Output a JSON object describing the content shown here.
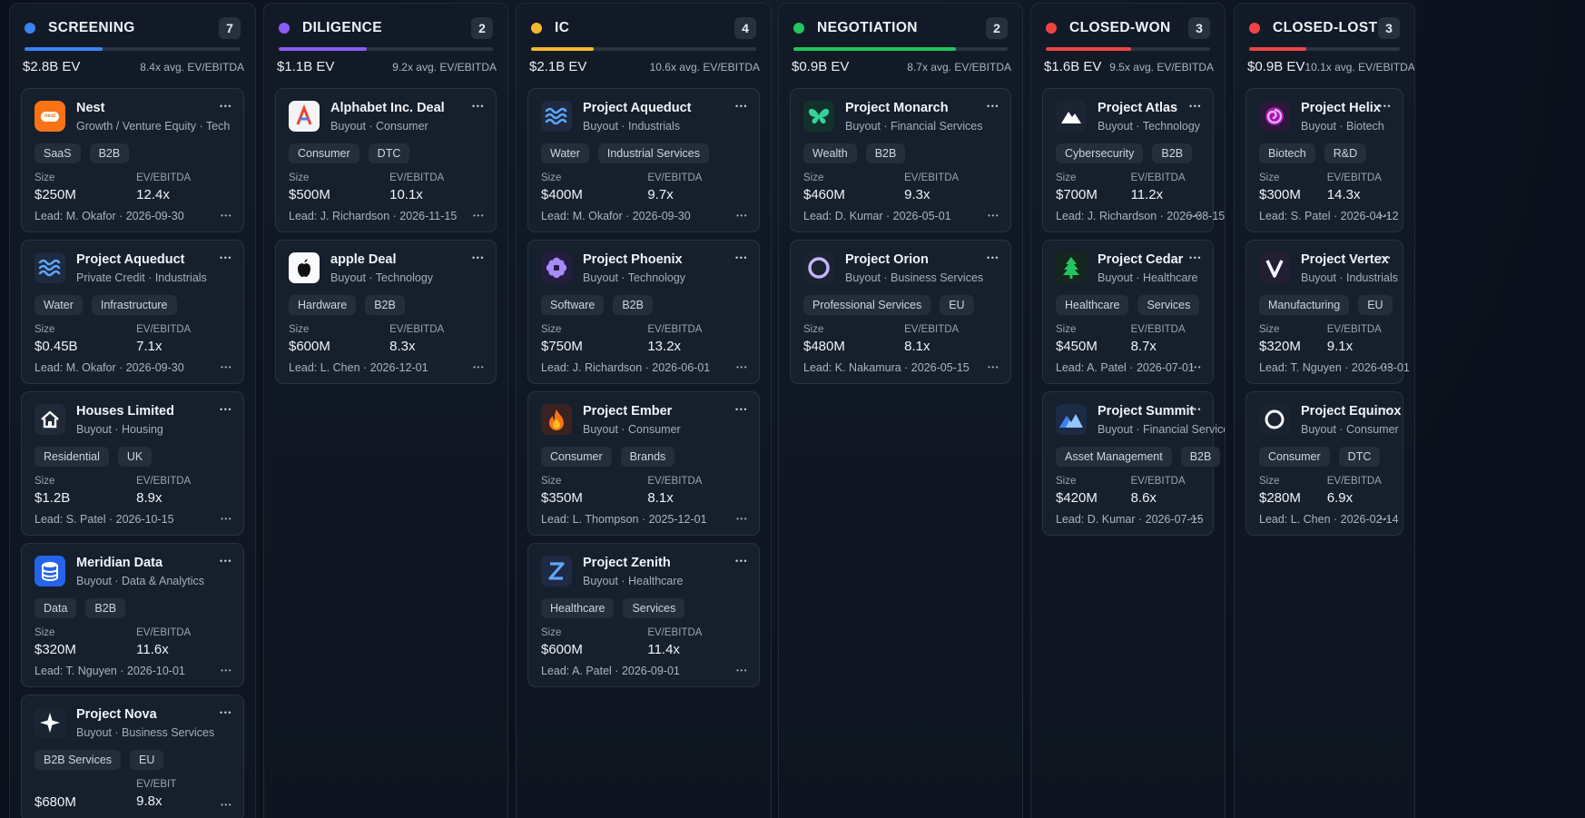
{
  "columns": [
    {
      "stage": "SCREENING",
      "count": "7",
      "dot": "#3b82f6",
      "bar": "#3b82f6",
      "progress": 0.36,
      "ev": "$2.8B EV",
      "avg": "8.4x avg. EV/EBITDA",
      "cards": [
        {
          "name": "Nest",
          "sub": "Growth / Venture Equity · Tech",
          "tags": [
            "SaaS",
            "B2B"
          ],
          "size_label": "Size",
          "size": "$250M",
          "ev_label": "EV/EBITDA",
          "ev": "12.4x",
          "lead": "Lead: M. Okafor · 2026-09-30",
          "icon": "nest-logo-icon"
        },
        {
          "name": "Project Aqueduct",
          "sub": "Private Credit · Industrials",
          "tags": [
            "Water",
            "Infrastructure"
          ],
          "size_label": "Size",
          "size": "$0.45B",
          "ev_label": "EV/EBITDA",
          "ev": "7.1x",
          "lead": "Lead: M. Okafor · 2026-09-30",
          "icon": "waves-icon"
        },
        {
          "name": "Houses Limited",
          "sub": "Buyout · Housing",
          "tags": [
            "Residential",
            "UK"
          ],
          "size_label": "Size",
          "size": "$1.2B",
          "ev_label": "EV/EBITDA",
          "ev": "8.9x",
          "lead": "Lead: S. Patel · 2026-10-15",
          "icon": "house-icon"
        },
        {
          "name": "Meridian Data",
          "sub": "Buyout · Data & Analytics",
          "tags": [
            "Data",
            "B2B"
          ],
          "size_label": "Size",
          "size": "$320M",
          "ev_label": "EV/EBITDA",
          "ev": "11.6x",
          "lead": "Lead: T. Nguyen · 2026-10-01",
          "icon": "database-icon"
        },
        {
          "name": "Project Nova",
          "sub": "Buyout · Business Services",
          "tags": [
            "B2B Services",
            "EU"
          ],
          "size_label": "",
          "size": "$680M",
          "ev_label": "EV/EBIT",
          "ev": "9.8x",
          "lead": "",
          "icon": "sparkle-icon"
        }
      ]
    },
    {
      "stage": "DILIGENCE",
      "count": "2",
      "dot": "#8b5cf6",
      "bar": "#8b5cf6",
      "progress": 0.41,
      "ev": "$1.1B EV",
      "avg": "9.2x avg. EV/EBITDA",
      "cards": [
        {
          "name": "Alphabet Inc. Deal",
          "sub": "Buyout · Consumer",
          "tags": [
            "Consumer",
            "DTC"
          ],
          "size_label": "Size",
          "size": "$500M",
          "ev_label": "EV/EBITDA",
          "ev": "10.1x",
          "lead": "Lead: J. Richardson · 2026-11-15",
          "icon": "letter-a-logo-icon"
        },
        {
          "name": "apple Deal",
          "sub": "Buyout · Technology",
          "tags": [
            "Hardware",
            "B2B"
          ],
          "size_label": "Size",
          "size": "$600M",
          "ev_label": "EV/EBITDA",
          "ev": "8.3x",
          "lead": "Lead: L. Chen · 2026-12-01",
          "icon": "apple-logo-icon"
        }
      ]
    },
    {
      "stage": "IC",
      "count": "4",
      "dot": "#f5b82e",
      "bar": "#f5b82e",
      "progress": 0.28,
      "ev": "$2.1B EV",
      "avg": "10.6x avg. EV/EBITDA",
      "cards": [
        {
          "name": "Project Aqueduct",
          "sub": "Buyout · Industrials",
          "tags": [
            "Water",
            "Industrial Services"
          ],
          "size_label": "Size",
          "size": "$400M",
          "ev_label": "EV/EBITDA",
          "ev": "9.7x",
          "lead": "Lead: M. Okafor · 2026-09-30",
          "icon": "waves-icon"
        },
        {
          "name": "Project Phoenix",
          "sub": "Buyout · Technology",
          "tags": [
            "Software",
            "B2B"
          ],
          "size_label": "Size",
          "size": "$750M",
          "ev_label": "EV/EBITDA",
          "ev": "13.2x",
          "lead": "Lead: J. Richardson · 2026-06-01",
          "icon": "flower-icon"
        },
        {
          "name": "Project Ember",
          "sub": "Buyout · Consumer",
          "tags": [
            "Consumer",
            "Brands"
          ],
          "size_label": "Size",
          "size": "$350M",
          "ev_label": "EV/EBITDA",
          "ev": "8.1x",
          "lead": "Lead: L. Thompson · 2025-12-01",
          "icon": "flame-icon"
        },
        {
          "name": "Project Zenith",
          "sub": "Buyout · Healthcare",
          "tags": [
            "Healthcare",
            "Services"
          ],
          "size_label": "Size",
          "size": "$600M",
          "ev_label": "EV/EBITDA",
          "ev": "11.4x",
          "lead": "Lead: A. Patel · 2026-09-01",
          "icon": "letter-z-icon"
        }
      ]
    },
    {
      "stage": "NEGOTIATION",
      "count": "2",
      "dot": "#22c55e",
      "bar": "#22c55e",
      "progress": 0.76,
      "ev": "$0.9B EV",
      "avg": "8.7x avg. EV/EBITDA",
      "cards": [
        {
          "name": "Project Monarch",
          "sub": "Buyout · Financial Services",
          "tags": [
            "Wealth",
            "B2B"
          ],
          "size_label": "Size",
          "size": "$460M",
          "ev_label": "EV/EBITDA",
          "ev": "9.3x",
          "lead": "Lead: D. Kumar · 2026-05-01",
          "icon": "butterfly-icon"
        },
        {
          "name": "Project Orion",
          "sub": "Buyout · Business Services",
          "tags": [
            "Professional Services",
            "EU"
          ],
          "size_label": "Size",
          "size": "$480M",
          "ev_label": "EV/EBITDA",
          "ev": "8.1x",
          "lead": "Lead: K. Nakamura · 2026-05-15",
          "icon": "ring-icon"
        }
      ]
    },
    {
      "stage": "CLOSED-WON",
      "count": "3",
      "dot": "#ef4444",
      "bar": "#ef4444",
      "progress": 0.52,
      "ev": "$1.6B EV",
      "avg": "9.5x avg. EV/EBITDA",
      "cards": [
        {
          "name": "Project Atlas",
          "sub": "Buyout · Technology",
          "tags": [
            "Cybersecurity",
            "B2B"
          ],
          "size_label": "Size",
          "size": "$700M",
          "ev_label": "EV/EBITDA",
          "ev": "11.2x",
          "lead": "Lead: J. Richardson · 2026-08-15",
          "icon": "mountain-icon"
        },
        {
          "name": "Project Cedar",
          "sub": "Buyout · Healthcare",
          "tags": [
            "Healthcare",
            "Services"
          ],
          "size_label": "Size",
          "size": "$450M",
          "ev_label": "EV/EBITDA",
          "ev": "8.7x",
          "lead": "Lead: A. Patel · 2026-07-01",
          "icon": "tree-icon"
        },
        {
          "name": "Project Summit",
          "sub": "Buyout · Financial Services",
          "tags": [
            "Asset Management",
            "B2B"
          ],
          "size_label": "Size",
          "size": "$420M",
          "ev_label": "EV/EBITDA",
          "ev": "8.6x",
          "lead": "Lead: D. Kumar · 2026-07-15",
          "icon": "peaks-icon"
        }
      ]
    },
    {
      "stage": "CLOSED-LOST",
      "count": "3",
      "dot": "#ef4444",
      "bar": "#ef4444",
      "progress": 0.38,
      "ev": "$0.9B EV",
      "avg": "10.1x avg. EV/EBITDA",
      "cards": [
        {
          "name": "Project Helix",
          "sub": "Buyout · Biotech",
          "tags": [
            "Biotech",
            "R&D"
          ],
          "size_label": "Size",
          "size": "$300M",
          "ev_label": "EV/EBITDA",
          "ev": "14.3x",
          "lead": "Lead: S. Patel · 2026-04-12",
          "icon": "spiral-icon"
        },
        {
          "name": "Project Vertex",
          "sub": "Buyout · Industrials",
          "tags": [
            "Manufacturing",
            "EU"
          ],
          "size_label": "Size",
          "size": "$320M",
          "ev_label": "EV/EBITDA",
          "ev": "9.1x",
          "lead": "Lead: T. Nguyen · 2026-03-01",
          "icon": "letter-v-icon"
        },
        {
          "name": "Project Equinox",
          "sub": "Buyout · Consumer",
          "tags": [
            "Consumer",
            "DTC"
          ],
          "size_label": "Size",
          "size": "$280M",
          "ev_label": "EV/EBITDA",
          "ev": "6.9x",
          "lead": "Lead: L. Chen · 2026-02-14",
          "icon": "circle-icon"
        }
      ]
    }
  ]
}
